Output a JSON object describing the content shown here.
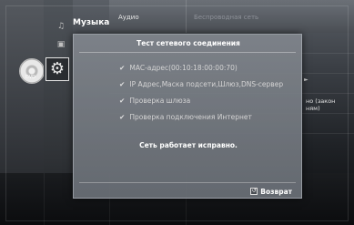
{
  "background": {
    "menu_music": "Музыка",
    "tab_audio": "Аудио",
    "tab_wireless": "Беспроводная сеть",
    "right_arrow": "►",
    "right_text_line1": "но (закон",
    "right_text_line2": "ням)",
    "dvd_label": "DVD"
  },
  "dialog": {
    "title": "Тест сетевого соединения",
    "checks": [
      {
        "tick": "✔",
        "label": "MAC-адрес(00:10:18:00:00:70)"
      },
      {
        "tick": "✔",
        "label": "IP Адрес,Маска подсети,Шлюз,DNS-сервер"
      },
      {
        "tick": "✔",
        "label": "Проверка шлюза"
      },
      {
        "tick": "✔",
        "label": "Проверка подключения Интернет"
      }
    ],
    "status": "Сеть работает исправно.",
    "back_label": "Возврат",
    "back_icon": "↺"
  },
  "icons": {
    "gear": "⚙",
    "music_note": "♫",
    "small_box": "▣"
  },
  "colors": {
    "dialog_bg": "#7e838a",
    "text": "#ffffff",
    "check_text": "#d4d4d4"
  }
}
